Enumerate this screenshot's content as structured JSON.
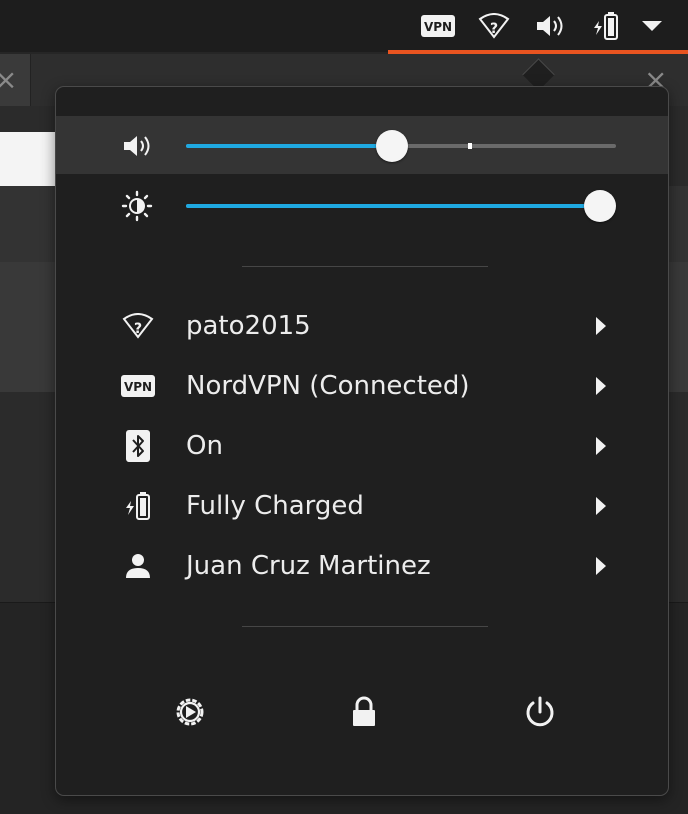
{
  "top_panel": {
    "indicators": [
      "vpn-icon",
      "wifi-unknown-icon",
      "volume-icon",
      "battery-charging-icon",
      "menu-arrow-icon"
    ],
    "vpn_badge": "VPN",
    "accent_color": "#e95420"
  },
  "popover": {
    "volume": {
      "icon": "volume-high-icon",
      "level": 0.48,
      "max_mark": 0.66
    },
    "brightness": {
      "icon": "brightness-icon",
      "level": 1.0
    },
    "slider_color": "#1fa9e1",
    "items": [
      {
        "icon": "wifi-unknown-icon",
        "label": "pato2015"
      },
      {
        "icon": "vpn-icon",
        "label": "NordVPN (Connected)",
        "badge": "VPN"
      },
      {
        "icon": "bluetooth-icon",
        "label": "On"
      },
      {
        "icon": "battery-charging-icon",
        "label": "Fully Charged"
      },
      {
        "icon": "user-icon",
        "label": "Juan Cruz Martinez"
      }
    ],
    "actions": [
      "settings-icon",
      "lock-icon",
      "power-icon"
    ]
  }
}
